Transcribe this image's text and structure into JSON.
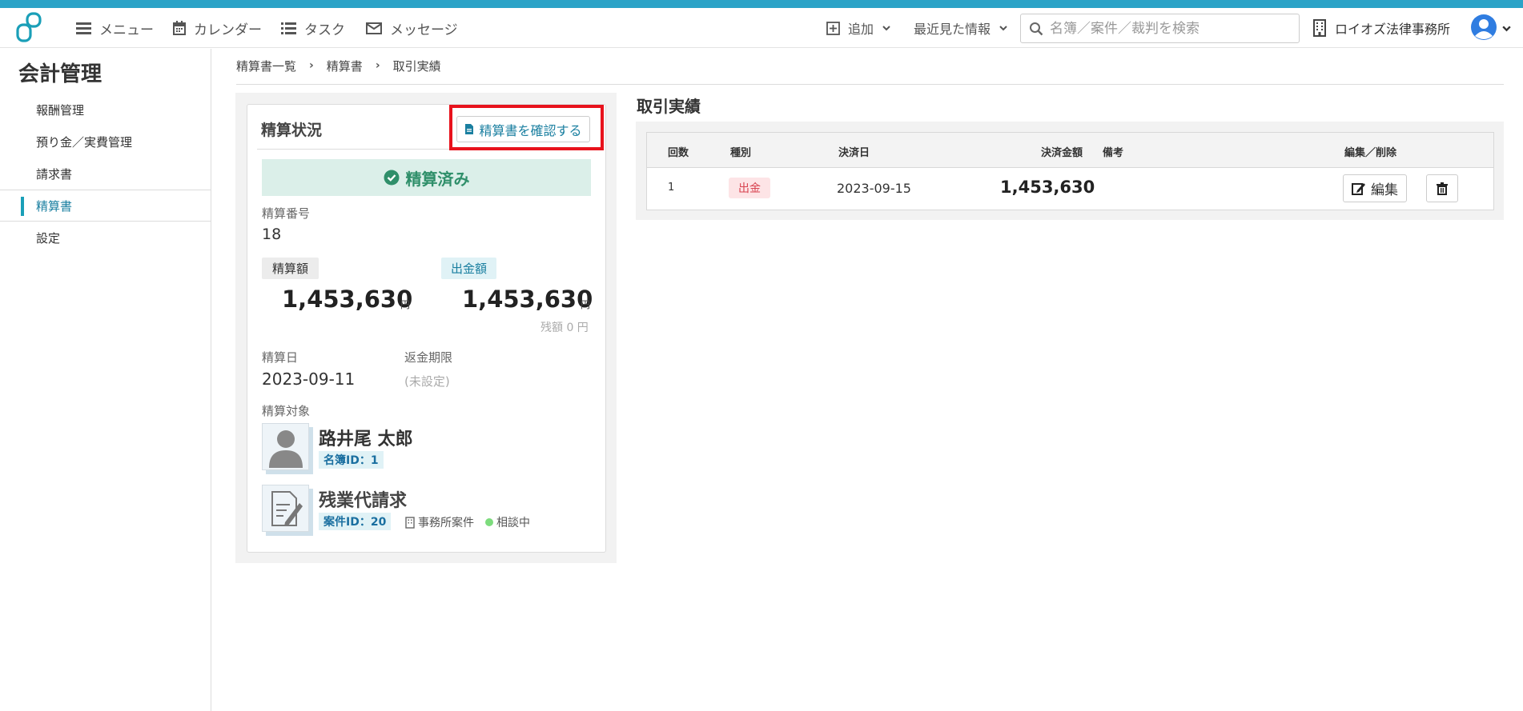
{
  "topbar": {
    "menu_label": "メニュー",
    "calendar_label": "カレンダー",
    "task_label": "タスク",
    "message_label": "メッセージ",
    "add_label": "追加",
    "recent_label": "最近見た情報",
    "search_placeholder": "名簿／案件／裁判を検索",
    "office_name": "ロイオズ法律事務所"
  },
  "sidebar": {
    "title": "会計管理",
    "items": [
      {
        "label": "報酬管理"
      },
      {
        "label": "預り金／実費管理"
      },
      {
        "label": "請求書"
      },
      {
        "label": "精算書"
      },
      {
        "label": "設定"
      }
    ]
  },
  "breadcrumb": [
    "精算書一覧",
    "精算書",
    "取引実績"
  ],
  "settlement": {
    "section_title": "精算状況",
    "confirm_button": "精算書を確認する",
    "status": "精算済み",
    "number_label": "精算番号",
    "number": "18",
    "amount_label": "精算額",
    "amount": "1,453,630",
    "payout_label": "出金額",
    "payout": "1,453,630",
    "yen": "円",
    "balance": "残額 0 円",
    "date_label": "精算日",
    "date": "2023-09-11",
    "deadline_label": "返金期限",
    "deadline": "(未設定)",
    "target_label": "精算対象",
    "person_name": "路井尾 太郎",
    "person_id": "名簿ID：1",
    "case_name": "残業代請求",
    "case_id": "案件ID：20",
    "case_type": "事務所案件",
    "case_status": "相談中"
  },
  "transactions": {
    "title": "取引実績",
    "headers": {
      "count": "回数",
      "type": "種別",
      "date": "決済日",
      "amount": "決済金額",
      "note": "備考",
      "actions": "編集／削除"
    },
    "rows": [
      {
        "count": "1",
        "type": "出金",
        "date": "2023-09-15",
        "amount": "1,453,630",
        "note": "",
        "edit": "編集"
      }
    ]
  },
  "colors": {
    "accent": "#2ba3c7",
    "status_green": "#2f8f6a",
    "highlight_red": "#e8121c"
  }
}
